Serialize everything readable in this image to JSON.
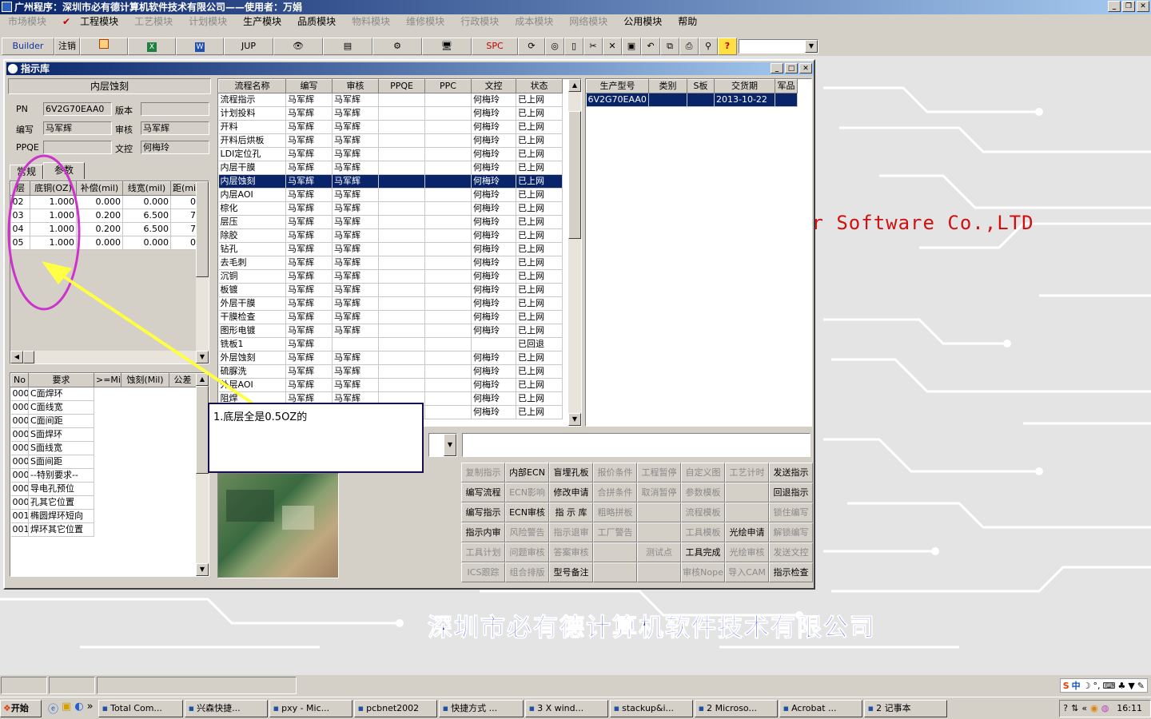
{
  "app": {
    "title": "广州程序：深圳市必有德计算机软件技术有限公司——使用者：万娟"
  },
  "menu": [
    {
      "label": "市场模块",
      "enabled": false
    },
    {
      "label": "工程模块",
      "enabled": true,
      "checked": true
    },
    {
      "label": "工艺模块",
      "enabled": false
    },
    {
      "label": "计划模块",
      "enabled": false
    },
    {
      "label": "生产模块",
      "enabled": true
    },
    {
      "label": "品质模块",
      "enabled": true
    },
    {
      "label": "物料模块",
      "enabled": false
    },
    {
      "label": "维修模块",
      "enabled": false
    },
    {
      "label": "行政模块",
      "enabled": false
    },
    {
      "label": "成本模块",
      "enabled": false
    },
    {
      "label": "网络模块",
      "enabled": false
    },
    {
      "label": "公用模块",
      "enabled": true
    },
    {
      "label": "帮助",
      "enabled": true
    }
  ],
  "toolbar": {
    "builder": "Builder",
    "logout": "注销",
    "jup": "JUP",
    "spc": "SPC"
  },
  "window": {
    "title": "指示库"
  },
  "panel": {
    "step_title": "内层蚀刻",
    "pn_label": "PN",
    "pn_value": "6V2G70EAA0",
    "version_label": "版本",
    "version_value": "",
    "writer_label": "编写",
    "writer_value": "马军辉",
    "review_label": "审核",
    "review_value": "马军辉",
    "ppqe_label": "PPQE",
    "ppqe_value": "",
    "doc_label": "文控",
    "doc_value": "何梅玲",
    "tab_common": "常规",
    "tab_params": "参数"
  },
  "layers": {
    "headers": [
      "层",
      "底铜(OZ)",
      "补偿(mil)",
      "线宽(mil)",
      "距(mi"
    ],
    "rows": [
      [
        "02",
        "1.000",
        "0.000",
        "0.000",
        "0"
      ],
      [
        "03",
        "1.000",
        "0.200",
        "6.500",
        "7"
      ],
      [
        "04",
        "1.000",
        "0.200",
        "6.500",
        "7"
      ],
      [
        "05",
        "1.000",
        "0.000",
        "0.000",
        "0"
      ]
    ]
  },
  "requirements": {
    "headers": [
      "No",
      "要求",
      ">=Mil",
      "蚀刻(Mil)",
      "公差"
    ],
    "rows": [
      [
        "000",
        "C面焊环"
      ],
      [
        "000",
        "C面线宽"
      ],
      [
        "000",
        "C面间距"
      ],
      [
        "000",
        "S面焊环"
      ],
      [
        "000",
        "S面线宽"
      ],
      [
        "000",
        "S面间距"
      ],
      [
        "000",
        "--特别要求--"
      ],
      [
        "000",
        "导电孔预位"
      ],
      [
        "000",
        "孔其它位置"
      ],
      [
        "001",
        "椭圆焊环短向"
      ],
      [
        "001",
        "焊环其它位置"
      ]
    ]
  },
  "process": {
    "headers": [
      "流程名称",
      "编写",
      "审核",
      "PPQE",
      "PPC",
      "文控",
      "状态"
    ],
    "selected_index": 6,
    "rows": [
      [
        "流程指示",
        "马军辉",
        "马军辉",
        "",
        "",
        "何梅玲",
        "已上网"
      ],
      [
        "计划投料",
        "马军辉",
        "马军辉",
        "",
        "",
        "何梅玲",
        "已上网"
      ],
      [
        "开料",
        "马军辉",
        "马军辉",
        "",
        "",
        "何梅玲",
        "已上网"
      ],
      [
        "开料后烘板",
        "马军辉",
        "马军辉",
        "",
        "",
        "何梅玲",
        "已上网"
      ],
      [
        "LDI定位孔",
        "马军辉",
        "马军辉",
        "",
        "",
        "何梅玲",
        "已上网"
      ],
      [
        "内层干膜",
        "马军辉",
        "马军辉",
        "",
        "",
        "何梅玲",
        "已上网"
      ],
      [
        "内层蚀刻",
        "马军辉",
        "马军辉",
        "",
        "",
        "何梅玲",
        "已上网"
      ],
      [
        "内层AOI",
        "马军辉",
        "马军辉",
        "",
        "",
        "何梅玲",
        "已上网"
      ],
      [
        "棕化",
        "马军辉",
        "马军辉",
        "",
        "",
        "何梅玲",
        "已上网"
      ],
      [
        "层压",
        "马军辉",
        "马军辉",
        "",
        "",
        "何梅玲",
        "已上网"
      ],
      [
        "除胶",
        "马军辉",
        "马军辉",
        "",
        "",
        "何梅玲",
        "已上网"
      ],
      [
        "钻孔",
        "马军辉",
        "马军辉",
        "",
        "",
        "何梅玲",
        "已上网"
      ],
      [
        "去毛刺",
        "马军辉",
        "马军辉",
        "",
        "",
        "何梅玲",
        "已上网"
      ],
      [
        "沉铜",
        "马军辉",
        "马军辉",
        "",
        "",
        "何梅玲",
        "已上网"
      ],
      [
        "板镀",
        "马军辉",
        "马军辉",
        "",
        "",
        "何梅玲",
        "已上网"
      ],
      [
        "外层干膜",
        "马军辉",
        "马军辉",
        "",
        "",
        "何梅玲",
        "已上网"
      ],
      [
        "干膜检查",
        "马军辉",
        "马军辉",
        "",
        "",
        "何梅玲",
        "已上网"
      ],
      [
        "图形电镀",
        "马军辉",
        "马军辉",
        "",
        "",
        "何梅玲",
        "已上网"
      ],
      [
        "铣板1",
        "马军辉",
        "",
        "",
        "",
        "",
        "已回退"
      ],
      [
        "外层蚀刻",
        "马军辉",
        "马军辉",
        "",
        "",
        "何梅玲",
        "已上网"
      ],
      [
        "硫脲洗",
        "马军辉",
        "马军辉",
        "",
        "",
        "何梅玲",
        "已上网"
      ],
      [
        "外层AOI",
        "马军辉",
        "马军辉",
        "",
        "",
        "何梅玲",
        "已上网"
      ],
      [
        "阻焊",
        "马军辉",
        "马军辉",
        "",
        "",
        "何梅玲",
        "已上网"
      ],
      [
        "",
        "",
        "",
        "",
        "",
        "何梅玲",
        "已上网"
      ]
    ]
  },
  "models": {
    "headers": [
      "生产型号",
      "类别",
      "S板",
      "交货期",
      "军品"
    ],
    "rows": [
      [
        "6V2G70EAA0",
        "",
        "",
        "2013-10-22",
        ""
      ]
    ]
  },
  "buttons": [
    {
      "label": "复制指示",
      "enabled": false
    },
    {
      "label": "内部ECN",
      "enabled": true
    },
    {
      "label": "盲埋孔板",
      "enabled": true
    },
    {
      "label": "报价条件",
      "enabled": false
    },
    {
      "label": "工程暂停",
      "enabled": false
    },
    {
      "label": "自定义图",
      "enabled": false
    },
    {
      "label": "工艺计时",
      "enabled": false
    },
    {
      "label": "发送指示",
      "enabled": true
    },
    {
      "label": "编写流程",
      "enabled": true
    },
    {
      "label": "ECN影响",
      "enabled": false
    },
    {
      "label": "修改申请",
      "enabled": true
    },
    {
      "label": "合拼条件",
      "enabled": false
    },
    {
      "label": "取消暂停",
      "enabled": false
    },
    {
      "label": "参数模板",
      "enabled": false
    },
    {
      "label": "",
      "enabled": false
    },
    {
      "label": "回退指示",
      "enabled": true
    },
    {
      "label": "编写指示",
      "enabled": true
    },
    {
      "label": "ECN审核",
      "enabled": true
    },
    {
      "label": "指 示 库",
      "enabled": true
    },
    {
      "label": "粗略拼板",
      "enabled": false
    },
    {
      "label": "",
      "enabled": false
    },
    {
      "label": "流程模板",
      "enabled": false
    },
    {
      "label": "",
      "enabled": false
    },
    {
      "label": "锁住编写",
      "enabled": false
    },
    {
      "label": "指示内审",
      "enabled": true
    },
    {
      "label": "风险警告",
      "enabled": false
    },
    {
      "label": "指示退审",
      "enabled": false
    },
    {
      "label": "工厂警告",
      "enabled": false
    },
    {
      "label": "",
      "enabled": false
    },
    {
      "label": "工具模板",
      "enabled": false
    },
    {
      "label": "光绘申请",
      "enabled": true
    },
    {
      "label": "解锁编写",
      "enabled": false
    },
    {
      "label": "工具计划",
      "enabled": false
    },
    {
      "label": "问题审核",
      "enabled": false
    },
    {
      "label": "答案审核",
      "enabled": false
    },
    {
      "label": "",
      "enabled": false
    },
    {
      "label": "测试点",
      "enabled": false
    },
    {
      "label": "工具完成",
      "enabled": true
    },
    {
      "label": "光绘审核",
      "enabled": false
    },
    {
      "label": "发送文控",
      "enabled": false
    },
    {
      "label": "ICS跟踪",
      "enabled": false
    },
    {
      "label": "组合排版",
      "enabled": false
    },
    {
      "label": "型号备注",
      "enabled": true
    },
    {
      "label": "",
      "enabled": false
    },
    {
      "label": "",
      "enabled": false
    },
    {
      "label": "审核Nope",
      "enabled": false
    },
    {
      "label": "导入CAM",
      "enabled": false
    },
    {
      "label": "指示检查",
      "enabled": true
    }
  ],
  "annotation": {
    "text": "1.底层全是0.5OZ的",
    "color": "#ffff44",
    "circle_color": "#cc33cc"
  },
  "background": {
    "company_en": "er Software Co.,LTD",
    "company_cn": "深圳市必有德计算机软件技术有限公司",
    "en_color": "#d01010",
    "cn_color": "#2a3cd8"
  },
  "taskbar": {
    "start": "开始",
    "tasks": [
      "Total Com...",
      "兴森快捷...",
      "pxy - Mic...",
      "pcbnet2002",
      "快捷方式 ...",
      "3 X wind...",
      "stackup&i...",
      "2 Microso...",
      "Acrobat ...",
      "2 记事本"
    ],
    "ime": "中",
    "clock": "16:11"
  }
}
